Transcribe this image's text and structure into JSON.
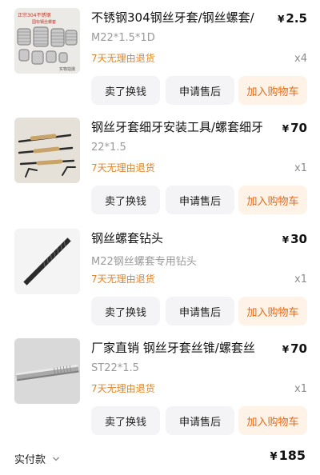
{
  "items": [
    {
      "title": "不锈钢304钢丝牙套/钢丝螺套/",
      "price_symbol": "¥",
      "price": "2.5",
      "spec": "M22*1.5*1D",
      "promise": "7天无理由退货",
      "qty": "x4",
      "actions": {
        "sell": "卖了换钱",
        "after_sale": "申请售后",
        "add_cart": "加入购物车"
      },
      "image_caption_1": "正宗304不锈钢",
      "image_caption_2": "国标钢丝螺套",
      "image_caption_3": "实物拍摄"
    },
    {
      "title": "钢丝牙套细牙安装工具/螺套细牙",
      "price_symbol": "¥",
      "price": "70",
      "spec": "22*1.5",
      "promise": "7天无理由退货",
      "qty": "x1",
      "actions": {
        "sell": "卖了换钱",
        "after_sale": "申请售后",
        "add_cart": "加入购物车"
      }
    },
    {
      "title": "钢丝螺套钻头",
      "price_symbol": "¥",
      "price": "30",
      "spec": "M22钢丝螺套专用钻头",
      "promise": "7天无理由退货",
      "qty": "x1",
      "actions": {
        "sell": "卖了换钱",
        "after_sale": "申请售后",
        "add_cart": "加入购物车"
      }
    },
    {
      "title": "厂家直销 钢丝牙套丝锥/螺套丝",
      "price_symbol": "¥",
      "price": "70",
      "spec": "ST22*1.5",
      "promise": "7天无理由退货",
      "qty": "x1",
      "actions": {
        "sell": "卖了换钱",
        "after_sale": "申请售后",
        "add_cart": "加入购物车"
      }
    }
  ],
  "footer": {
    "paid_label": "实付款",
    "total_symbol": "¥",
    "total": "185"
  },
  "colors": {
    "accent_orange": "#ea6a16",
    "cart_bg": "#fff2e6",
    "promise_orange": "#e0852b",
    "button_bg": "#f4f4f6"
  },
  "icons": [
    "chevron-down-icon"
  ]
}
